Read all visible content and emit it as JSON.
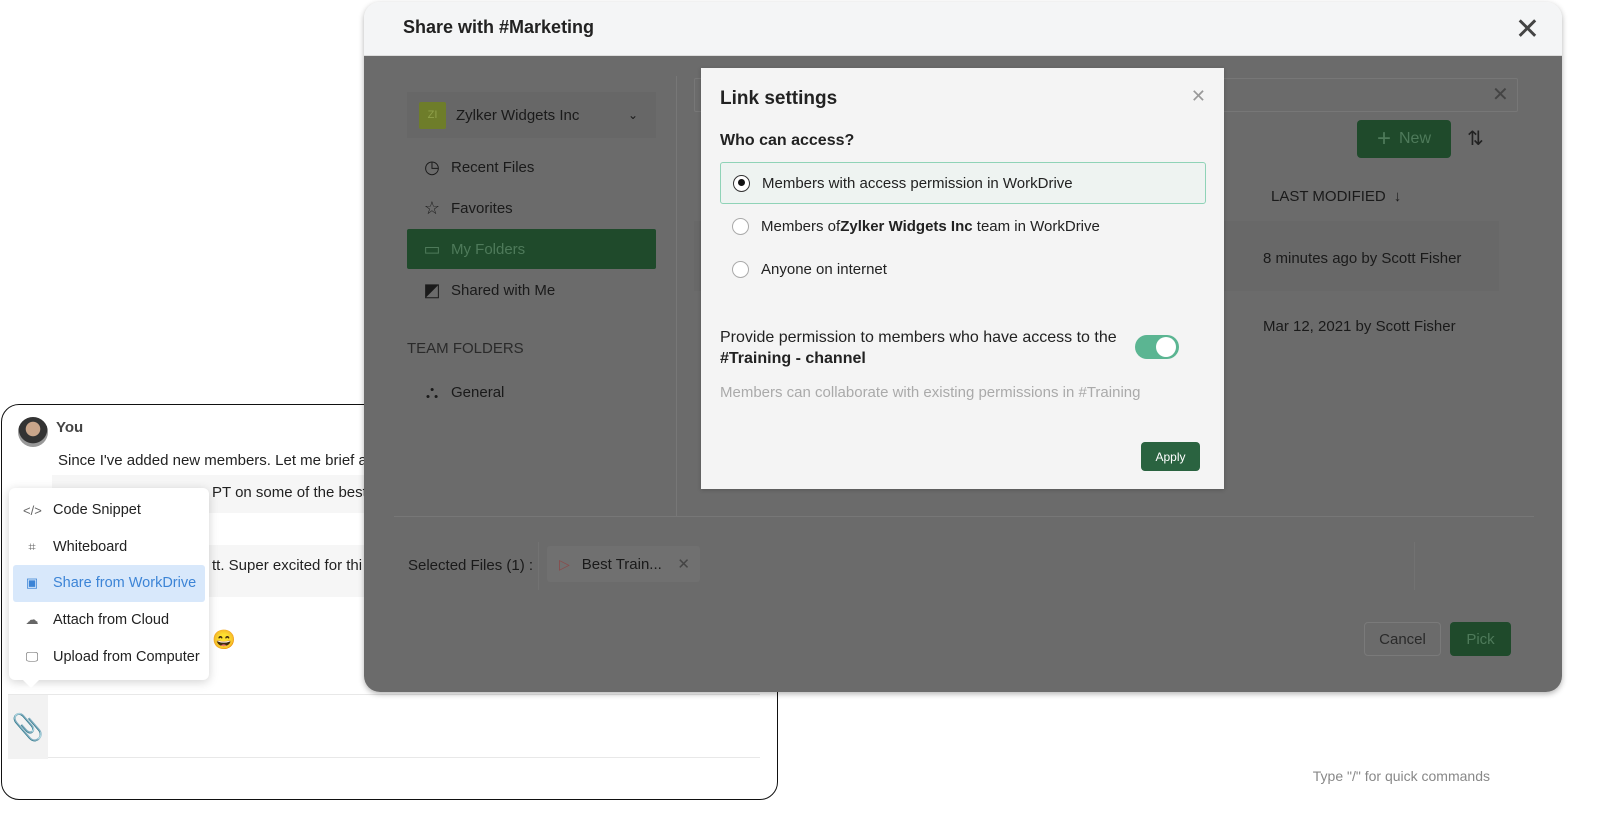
{
  "chat": {
    "sender": "You",
    "lines": [
      "Since I've added new members. Let me brief ag",
      "PT on some of the best t",
      "tt. Super excited for thi"
    ],
    "emoji": "😄",
    "attach_menu": [
      {
        "icon": "code-icon",
        "label": "Code Snippet"
      },
      {
        "icon": "whiteboard-icon",
        "label": "Whiteboard"
      },
      {
        "icon": "workdrive-icon",
        "label": "Share from WorkDrive",
        "active": true
      },
      {
        "icon": "cloud-upload-icon",
        "label": "Attach from Cloud"
      },
      {
        "icon": "computer-icon",
        "label": "Upload from Computer"
      }
    ],
    "compose_hint": "Type \"/\" for quick commands"
  },
  "modal": {
    "title": "Share with #Marketing",
    "team": {
      "initials": "ZI",
      "name": "Zylker Widgets Inc"
    },
    "nav": [
      {
        "icon": "clock-icon",
        "label": "Recent Files"
      },
      {
        "icon": "star-icon",
        "label": "Favorites"
      },
      {
        "icon": "folder-icon",
        "label": "My Folders",
        "active": true
      },
      {
        "icon": "shared-folder-icon",
        "label": "Shared with Me"
      }
    ],
    "team_folders_heading": "TEAM FOLDERS",
    "team_folders": [
      {
        "icon": "team-folder-icon",
        "label": "General"
      }
    ],
    "new_label": "New",
    "column_header": "LAST MODIFIED",
    "rows": [
      "8 minutes ago by Scott Fisher",
      "Mar 12, 2021 by Scott Fisher"
    ],
    "selected_label": "Selected Files (1) :",
    "selected_file": "Best Train...",
    "cancel_label": "Cancel",
    "pick_label": "Pick"
  },
  "link_settings": {
    "title": "Link settings",
    "question": "Who can access?",
    "options": [
      {
        "pre": "Members with access permission in WorkDrive",
        "bold": "",
        "post": "",
        "selected": true
      },
      {
        "pre": "Members of ",
        "bold": "Zylker Widgets Inc",
        "post": " team in WorkDrive",
        "selected": false
      },
      {
        "pre": "Anyone on internet",
        "bold": "",
        "post": "",
        "selected": false
      }
    ],
    "permission_text": "Provide permission to members who have access to the",
    "permission_channel": "#Training - channel",
    "permission_toggle_on": true,
    "helper": "Members can collaborate with existing permissions in #Training",
    "apply_label": "Apply"
  },
  "colors": {
    "accent_green": "#2a6340",
    "toggle": "#5bb592",
    "highlight_blue": "#3c84d6"
  }
}
